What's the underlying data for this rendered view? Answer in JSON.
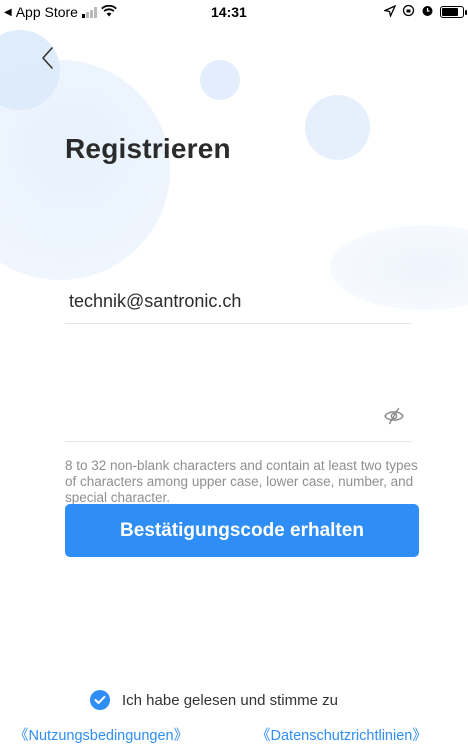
{
  "status_bar": {
    "back_app": "App Store",
    "time": "14:31",
    "icons": [
      "location-arrow-icon",
      "lock-rotation-icon",
      "alarm-icon",
      "battery-icon"
    ]
  },
  "nav": {
    "back_icon": "chevron-left-icon"
  },
  "title": "Registrieren",
  "form": {
    "email_value": "technik@santronic.ch",
    "password_value": "",
    "password_toggle_icon": "eye-hidden-icon",
    "password_hint": "8 to 32 non-blank characters and contain at least two types of characters among upper case, lower case, number, and special character."
  },
  "button": {
    "get_code_label": "Bestätigungscode erhalten"
  },
  "agreement": {
    "checked": true,
    "label": "Ich habe gelesen und stimme zu",
    "terms_link": "《Nutzungsbedingungen》",
    "privacy_link": "《Datenschutzrichtlinien》"
  },
  "colors": {
    "accent": "#2f8ef5",
    "title": "#2b2b2b",
    "hint": "#8f8f8f",
    "bubble": "#e3eefc"
  }
}
